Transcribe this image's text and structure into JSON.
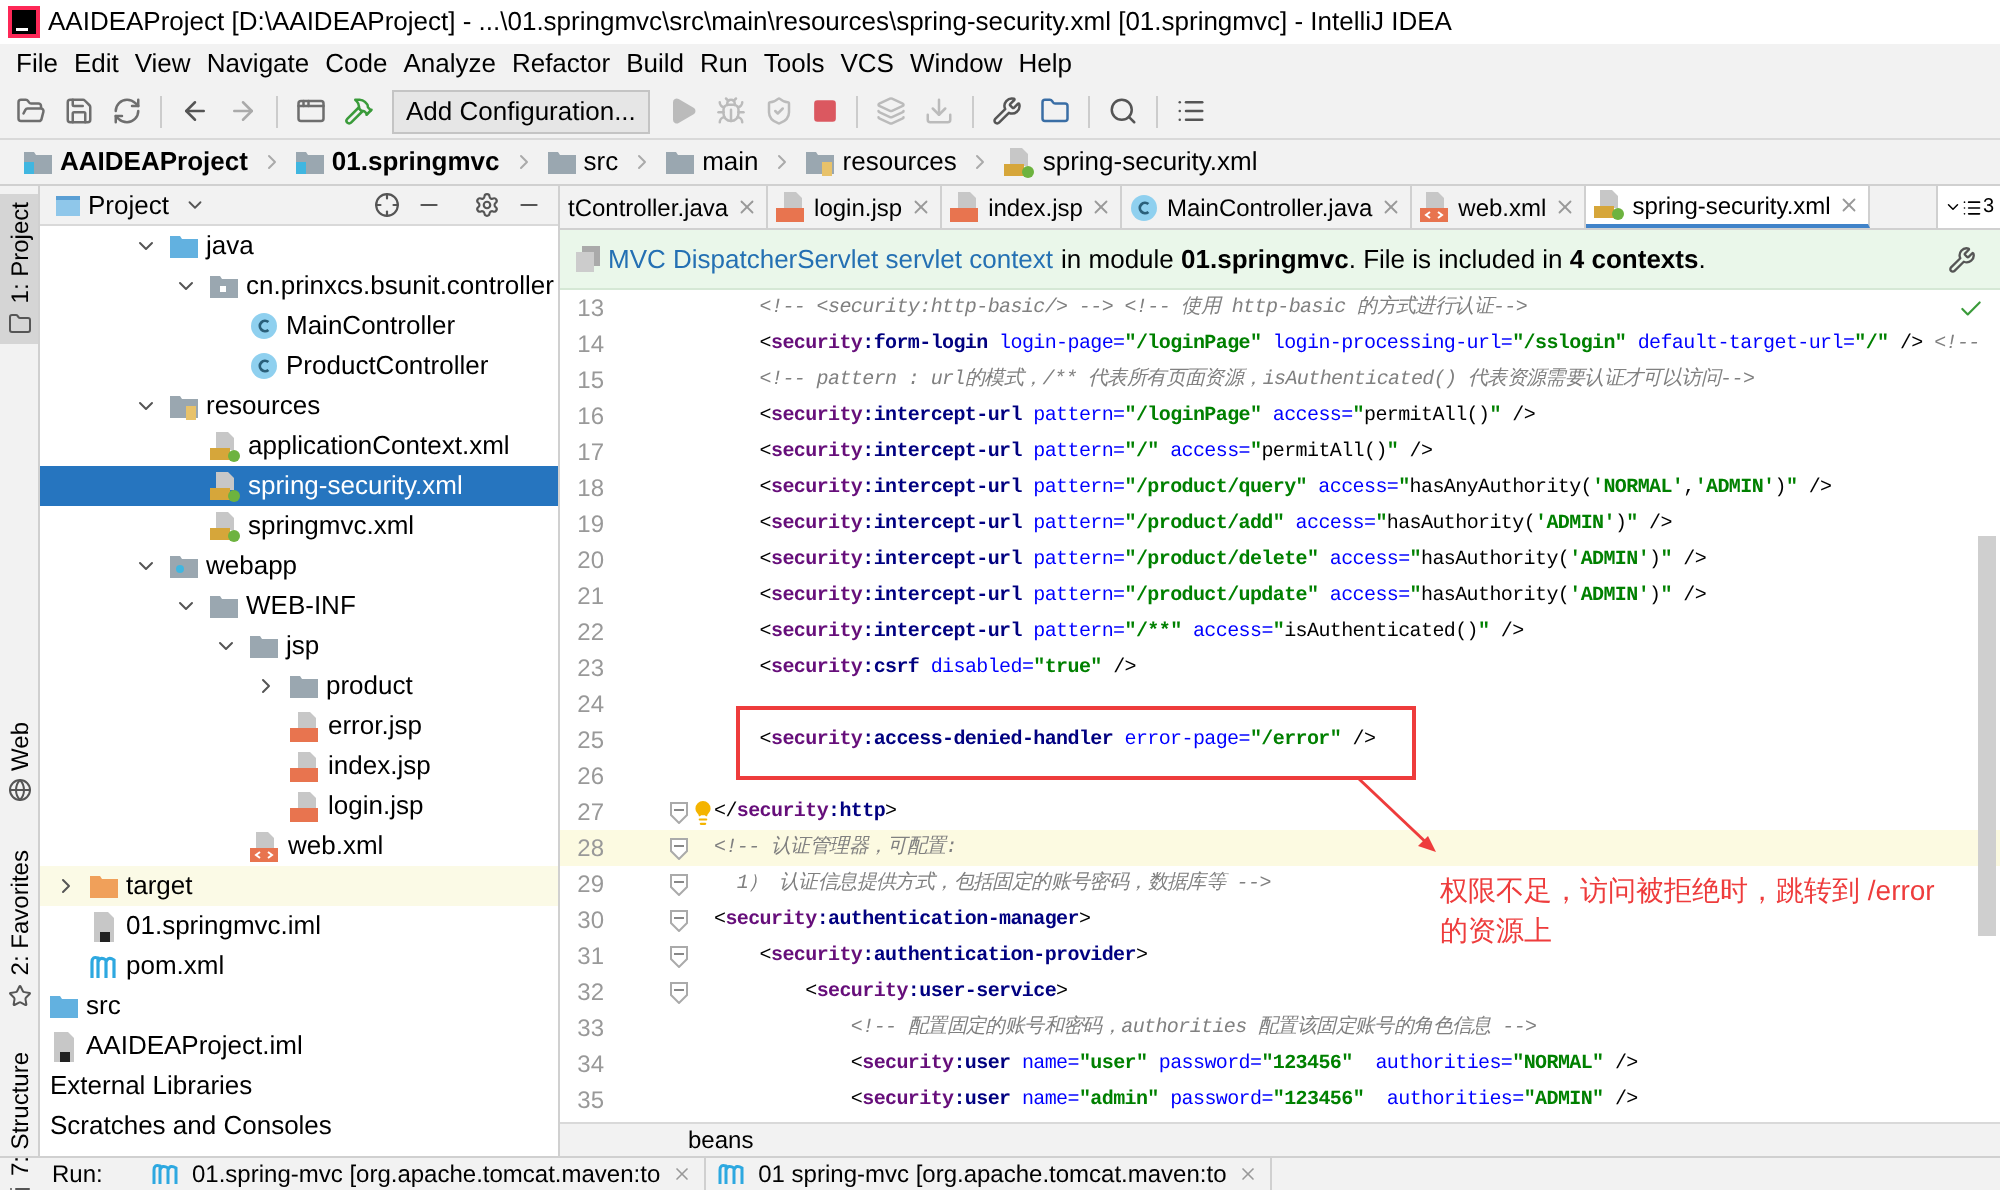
{
  "window": {
    "title": "AAIDEAProject [D:\\AAIDEAProject] - ...\\01.springmvc\\src\\main\\resources\\spring-security.xml [01.springmvc] - IntelliJ IDEA"
  },
  "menu": [
    "File",
    "Edit",
    "View",
    "Navigate",
    "Code",
    "Analyze",
    "Refactor",
    "Build",
    "Run",
    "Tools",
    "VCS",
    "Window",
    "Help"
  ],
  "toolbar": {
    "run_config": "Add Configuration..."
  },
  "breadcrumbs": [
    {
      "label": "AAIDEAProject",
      "kind": "module",
      "bold": true
    },
    {
      "label": "01.springmvc",
      "kind": "module",
      "bold": true
    },
    {
      "label": "src",
      "kind": "folder",
      "bold": false
    },
    {
      "label": "main",
      "kind": "folder",
      "bold": false
    },
    {
      "label": "resources",
      "kind": "resources",
      "bold": false
    },
    {
      "label": "spring-security.xml",
      "kind": "spring-xml",
      "bold": false
    }
  ],
  "tool_stripe": [
    {
      "label": "1: Project",
      "kind": "folder",
      "selected": true
    },
    {
      "label": "Web",
      "kind": "globe",
      "selected": false
    },
    {
      "label": "2: Favorites",
      "kind": "star",
      "selected": false
    },
    {
      "label": "7: Structure",
      "kind": "structure",
      "selected": false
    }
  ],
  "project_panel": {
    "title": "Project",
    "tree": [
      {
        "children": [
          {
            "children": [
              {
                "children": [
                  {
                    "label": "java",
                    "kind": "source-folder",
                    "expanded": true,
                    "selected": false,
                    "highlighted": false,
                    "children": [
                      {
                        "label": "cn.prinxcs.bsunit.controller",
                        "kind": "package",
                        "expanded": true,
                        "selected": false,
                        "highlighted": false,
                        "children": [
                          {
                            "label": "MainController",
                            "kind": "class",
                            "selected": false,
                            "highlighted": false
                          },
                          {
                            "label": "ProductController",
                            "kind": "class",
                            "selected": false,
                            "highlighted": false
                          }
                        ]
                      }
                    ]
                  },
                  {
                    "label": "resources",
                    "kind": "resources",
                    "expanded": true,
                    "selected": false,
                    "highlighted": false,
                    "children": [
                      {
                        "label": "applicationContext.xml",
                        "kind": "spring-xml",
                        "selected": false,
                        "highlighted": false
                      },
                      {
                        "label": "spring-security.xml",
                        "kind": "spring-xml",
                        "selected": true,
                        "highlighted": false
                      },
                      {
                        "label": "springmvc.xml",
                        "kind": "spring-xml",
                        "selected": false,
                        "highlighted": false
                      }
                    ]
                  },
                  {
                    "label": "webapp",
                    "kind": "web-folder",
                    "expanded": true,
                    "selected": false,
                    "highlighted": false,
                    "children": [
                      {
                        "label": "WEB-INF",
                        "kind": "folder",
                        "expanded": true,
                        "selected": false,
                        "highlighted": false,
                        "children": [
                          {
                            "label": "jsp",
                            "kind": "folder",
                            "expanded": true,
                            "selected": false,
                            "highlighted": false,
                            "children": [
                              {
                                "label": "product",
                                "kind": "folder",
                                "expanded": false,
                                "selected": false,
                                "highlighted": false
                              },
                              {
                                "label": "error.jsp",
                                "kind": "jsp",
                                "selected": false,
                                "highlighted": false
                              },
                              {
                                "label": "index.jsp",
                                "kind": "jsp",
                                "selected": false,
                                "highlighted": false
                              },
                              {
                                "label": "login.jsp",
                                "kind": "jsp",
                                "selected": false,
                                "highlighted": false
                              }
                            ]
                          },
                          {
                            "label": "web.xml",
                            "kind": "web-xml",
                            "selected": false,
                            "highlighted": false
                          }
                        ]
                      }
                    ]
                  }
                ]
              }
            ]
          },
          {
            "label": "target",
            "kind": "excluded-folder",
            "expanded": false,
            "selected": false,
            "highlighted": true
          },
          {
            "label": "01.springmvc.iml",
            "kind": "iml",
            "selected": false,
            "highlighted": false
          },
          {
            "label": "pom.xml",
            "kind": "maven",
            "selected": false,
            "highlighted": false
          }
        ]
      },
      {
        "label": "src",
        "kind": "source-folder",
        "selected": false,
        "highlighted": false
      },
      {
        "label": "AAIDEAProject.iml",
        "kind": "iml",
        "selected": false,
        "highlighted": false
      },
      {
        "label": "External Libraries",
        "kind": "plain",
        "selected": false,
        "highlighted": false
      },
      {
        "label": "Scratches and Consoles",
        "kind": "plain",
        "selected": false,
        "highlighted": false
      }
    ]
  },
  "editor_tabs": [
    {
      "label": "tController.java",
      "kind": "plain",
      "selected": false
    },
    {
      "label": "login.jsp",
      "kind": "jsp",
      "selected": false
    },
    {
      "label": "index.jsp",
      "kind": "jsp",
      "selected": false
    },
    {
      "label": "MainController.java",
      "kind": "class",
      "selected": false
    },
    {
      "label": "web.xml",
      "kind": "web-xml",
      "selected": false
    },
    {
      "label": "spring-security.xml",
      "kind": "spring-xml",
      "selected": true
    }
  ],
  "tab_overflow": "3",
  "context_banner": {
    "link": "MVC DispatcherServlet servlet context",
    "text": "in module **01.springmvc**. File is included in **4 contexts**."
  },
  "code": [
    {
      "number": "13",
      "current": false,
      "fold_marker": false,
      "bulb": false,
      "tokens": [
        {
          "kind": "comment",
          "text": "    <!-- <security:http-basic/> --> <!-- 使用 http-basic 的方式进行认证-->"
        }
      ]
    },
    {
      "number": "14",
      "current": false,
      "fold_marker": false,
      "bulb": false,
      "tokens": [
        {
          "kind": "p",
          "text": "    <"
        },
        {
          "kind": "ns",
          "text": "security"
        },
        {
          "kind": "tag",
          "text": ":form-login"
        },
        {
          "kind": "attr",
          "text": " login-page="
        },
        {
          "kind": "val",
          "text": "\"/loginPage\""
        },
        {
          "kind": "attr",
          "text": " login-processing-url="
        },
        {
          "kind": "val",
          "text": "\"/sslogin\""
        },
        {
          "kind": "attr",
          "text": " default-target-url="
        },
        {
          "kind": "val",
          "text": "\"/\""
        },
        {
          "kind": "p",
          "text": " /> "
        },
        {
          "kind": "comment",
          "text": "<!--"
        }
      ]
    },
    {
      "number": "15",
      "current": false,
      "fold_marker": false,
      "bulb": false,
      "tokens": [
        {
          "kind": "comment",
          "text": "    <!-- pattern : url的模式，/** 代表所有页面资源，isAuthenticated() 代表资源需要认证才可以访问-->"
        }
      ]
    },
    {
      "number": "16",
      "current": false,
      "fold_marker": false,
      "bulb": false,
      "tokens": [
        {
          "kind": "p",
          "text": "    <"
        },
        {
          "kind": "ns",
          "text": "security"
        },
        {
          "kind": "tag",
          "text": ":intercept-url"
        },
        {
          "kind": "attr",
          "text": " pattern="
        },
        {
          "kind": "val",
          "text": "\"/loginPage\""
        },
        {
          "kind": "attr",
          "text": " access="
        },
        {
          "kind": "val",
          "text": "\""
        },
        {
          "kind": "text",
          "text": "permitAll()"
        },
        {
          "kind": "val",
          "text": "\""
        },
        {
          "kind": "p",
          "text": " />"
        }
      ]
    },
    {
      "number": "17",
      "current": false,
      "fold_marker": false,
      "bulb": false,
      "tokens": [
        {
          "kind": "p",
          "text": "    <"
        },
        {
          "kind": "ns",
          "text": "security"
        },
        {
          "kind": "tag",
          "text": ":intercept-url"
        },
        {
          "kind": "attr",
          "text": " pattern="
        },
        {
          "kind": "val",
          "text": "\"/\""
        },
        {
          "kind": "attr",
          "text": " access="
        },
        {
          "kind": "val",
          "text": "\""
        },
        {
          "kind": "text",
          "text": "permitAll()"
        },
        {
          "kind": "val",
          "text": "\""
        },
        {
          "kind": "p",
          "text": " />"
        }
      ]
    },
    {
      "number": "18",
      "current": false,
      "fold_marker": false,
      "bulb": false,
      "tokens": [
        {
          "kind": "p",
          "text": "    <"
        },
        {
          "kind": "ns",
          "text": "security"
        },
        {
          "kind": "tag",
          "text": ":intercept-url"
        },
        {
          "kind": "attr",
          "text": " pattern="
        },
        {
          "kind": "val",
          "text": "\"/product/query\""
        },
        {
          "kind": "attr",
          "text": " access="
        },
        {
          "kind": "val",
          "text": "\""
        },
        {
          "kind": "text",
          "text": "hasAnyAuthority("
        },
        {
          "kind": "val",
          "text": "'NORMAL'"
        },
        {
          "kind": "text",
          "text": ","
        },
        {
          "kind": "val",
          "text": "'ADMIN'"
        },
        {
          "kind": "text",
          "text": ")"
        },
        {
          "kind": "val",
          "text": "\""
        },
        {
          "kind": "p",
          "text": " />"
        }
      ]
    },
    {
      "number": "19",
      "current": false,
      "fold_marker": false,
      "bulb": false,
      "tokens": [
        {
          "kind": "p",
          "text": "    <"
        },
        {
          "kind": "ns",
          "text": "security"
        },
        {
          "kind": "tag",
          "text": ":intercept-url"
        },
        {
          "kind": "attr",
          "text": " pattern="
        },
        {
          "kind": "val",
          "text": "\"/product/add\""
        },
        {
          "kind": "attr",
          "text": " access="
        },
        {
          "kind": "val",
          "text": "\""
        },
        {
          "kind": "text",
          "text": "hasAuthority("
        },
        {
          "kind": "val",
          "text": "'ADMIN'"
        },
        {
          "kind": "text",
          "text": ")"
        },
        {
          "kind": "val",
          "text": "\""
        },
        {
          "kind": "p",
          "text": " />"
        }
      ]
    },
    {
      "number": "20",
      "current": false,
      "fold_marker": false,
      "bulb": false,
      "tokens": [
        {
          "kind": "p",
          "text": "    <"
        },
        {
          "kind": "ns",
          "text": "security"
        },
        {
          "kind": "tag",
          "text": ":intercept-url"
        },
        {
          "kind": "attr",
          "text": " pattern="
        },
        {
          "kind": "val",
          "text": "\"/product/delete\""
        },
        {
          "kind": "attr",
          "text": " access="
        },
        {
          "kind": "val",
          "text": "\""
        },
        {
          "kind": "text",
          "text": "hasAuthority("
        },
        {
          "kind": "val",
          "text": "'ADMIN'"
        },
        {
          "kind": "text",
          "text": ")"
        },
        {
          "kind": "val",
          "text": "\""
        },
        {
          "kind": "p",
          "text": " />"
        }
      ]
    },
    {
      "number": "21",
      "current": false,
      "fold_marker": false,
      "bulb": false,
      "tokens": [
        {
          "kind": "p",
          "text": "    <"
        },
        {
          "kind": "ns",
          "text": "security"
        },
        {
          "kind": "tag",
          "text": ":intercept-url"
        },
        {
          "kind": "attr",
          "text": " pattern="
        },
        {
          "kind": "val",
          "text": "\"/product/update\""
        },
        {
          "kind": "attr",
          "text": " access="
        },
        {
          "kind": "val",
          "text": "\""
        },
        {
          "kind": "text",
          "text": "hasAuthority("
        },
        {
          "kind": "val",
          "text": "'ADMIN'"
        },
        {
          "kind": "text",
          "text": ")"
        },
        {
          "kind": "val",
          "text": "\""
        },
        {
          "kind": "p",
          "text": " />"
        }
      ]
    },
    {
      "number": "22",
      "current": false,
      "fold_marker": false,
      "bulb": false,
      "tokens": [
        {
          "kind": "p",
          "text": "    <"
        },
        {
          "kind": "ns",
          "text": "security"
        },
        {
          "kind": "tag",
          "text": ":intercept-url"
        },
        {
          "kind": "attr",
          "text": " pattern="
        },
        {
          "kind": "val",
          "text": "\"/**\""
        },
        {
          "kind": "attr",
          "text": " access="
        },
        {
          "kind": "val",
          "text": "\""
        },
        {
          "kind": "text",
          "text": "isAuthenticated()"
        },
        {
          "kind": "val",
          "text": "\""
        },
        {
          "kind": "p",
          "text": " />"
        }
      ]
    },
    {
      "number": "23",
      "current": false,
      "fold_marker": false,
      "bulb": false,
      "tokens": [
        {
          "kind": "p",
          "text": "    <"
        },
        {
          "kind": "ns",
          "text": "security"
        },
        {
          "kind": "tag",
          "text": ":csrf"
        },
        {
          "kind": "attr",
          "text": " disabled="
        },
        {
          "kind": "val",
          "text": "\"true\""
        },
        {
          "kind": "p",
          "text": " />"
        }
      ]
    },
    {
      "number": "24",
      "current": false,
      "fold_marker": false,
      "bulb": false
    },
    {
      "number": "25",
      "current": false,
      "fold_marker": false,
      "bulb": false,
      "tokens": [
        {
          "kind": "p",
          "text": "    <"
        },
        {
          "kind": "ns",
          "text": "security"
        },
        {
          "kind": "tag",
          "text": ":access-denied-handler"
        },
        {
          "kind": "attr",
          "text": " error-page="
        },
        {
          "kind": "val",
          "text": "\"/error\""
        },
        {
          "kind": "p",
          "text": " />"
        }
      ]
    },
    {
      "number": "26",
      "current": false,
      "fold_marker": false,
      "bulb": false
    },
    {
      "number": "27",
      "current": false,
      "fold_marker": true,
      "bulb": true,
      "tokens": [
        {
          "kind": "p",
          "text": "</"
        },
        {
          "kind": "ns",
          "text": "security"
        },
        {
          "kind": "tag",
          "text": ":http"
        },
        {
          "kind": "p",
          "text": ">"
        }
      ]
    },
    {
      "number": "28",
      "current": true,
      "fold_marker": true,
      "bulb": false,
      "tokens": [
        {
          "kind": "comment",
          "text": "<!-- 认证管理器，可配置:"
        }
      ]
    },
    {
      "number": "29",
      "current": false,
      "fold_marker": true,
      "bulb": false,
      "tokens": [
        {
          "kind": "comment",
          "text": "  1） 认证信息提供方式，包括固定的账号密码，数据库等 -->"
        }
      ]
    },
    {
      "number": "30",
      "current": false,
      "fold_marker": true,
      "bulb": false,
      "tokens": [
        {
          "kind": "p",
          "text": "<"
        },
        {
          "kind": "ns",
          "text": "security"
        },
        {
          "kind": "tag",
          "text": ":authentication-manager"
        },
        {
          "kind": "p",
          "text": ">"
        }
      ]
    },
    {
      "number": "31",
      "current": false,
      "fold_marker": true,
      "bulb": false,
      "tokens": [
        {
          "kind": "p",
          "text": "    <"
        },
        {
          "kind": "ns",
          "text": "security"
        },
        {
          "kind": "tag",
          "text": ":authentication-provider"
        },
        {
          "kind": "p",
          "text": ">"
        }
      ]
    },
    {
      "number": "32",
      "current": false,
      "fold_marker": true,
      "bulb": false,
      "tokens": [
        {
          "kind": "p",
          "text": "        <"
        },
        {
          "kind": "ns",
          "text": "security"
        },
        {
          "kind": "tag",
          "text": ":user-service"
        },
        {
          "kind": "p",
          "text": ">"
        }
      ]
    },
    {
      "number": "33",
      "current": false,
      "fold_marker": false,
      "bulb": false,
      "tokens": [
        {
          "kind": "comment",
          "text": "            <!-- 配置固定的账号和密码，authorities 配置该固定账号的角色信息 -->"
        }
      ]
    },
    {
      "number": "34",
      "current": false,
      "fold_marker": false,
      "bulb": false,
      "tokens": [
        {
          "kind": "p",
          "text": "            <"
        },
        {
          "kind": "ns",
          "text": "security"
        },
        {
          "kind": "tag",
          "text": ":user"
        },
        {
          "kind": "attr",
          "text": " name="
        },
        {
          "kind": "val",
          "text": "\"user\""
        },
        {
          "kind": "attr",
          "text": " password="
        },
        {
          "kind": "val",
          "text": "\"123456\""
        },
        {
          "kind": "attr",
          "text": "  authorities="
        },
        {
          "kind": "val",
          "text": "\"NORMAL\""
        },
        {
          "kind": "p",
          "text": " />"
        }
      ]
    },
    {
      "number": "35",
      "current": false,
      "fold_marker": false,
      "bulb": false,
      "tokens": [
        {
          "kind": "p",
          "text": "            <"
        },
        {
          "kind": "ns",
          "text": "security"
        },
        {
          "kind": "tag",
          "text": ":user"
        },
        {
          "kind": "attr",
          "text": " name="
        },
        {
          "kind": "val",
          "text": "\"admin\""
        },
        {
          "kind": "attr",
          "text": " password="
        },
        {
          "kind": "val",
          "text": "\"123456\""
        },
        {
          "kind": "attr",
          "text": "  authorities="
        },
        {
          "kind": "val",
          "text": "\"ADMIN\""
        },
        {
          "kind": "p",
          "text": " />"
        }
      ]
    }
  ],
  "editor_breadcrumb": "beans",
  "annotation": {
    "note": "权限不足，访问被拒绝时，跳转到 /error 的资源上"
  },
  "run_bar": {
    "label": "Run:",
    "tabs": [
      "01.spring-mvc [org.apache.tomcat.maven:to",
      "01 spring-mvc [org.apache.tomcat.maven:to"
    ]
  }
}
